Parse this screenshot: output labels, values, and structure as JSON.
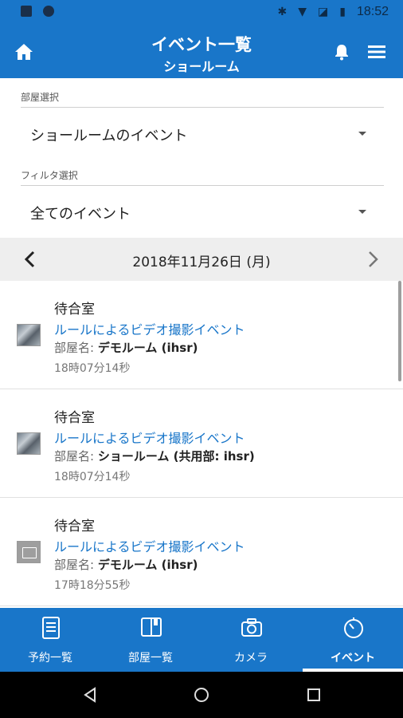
{
  "status_bar": {
    "time": "18:52"
  },
  "app_bar": {
    "title": "イベント一覧",
    "subtitle": "ショールーム"
  },
  "room_select": {
    "label": "部屋選択",
    "value": "ショールームのイベント"
  },
  "filter_select": {
    "label": "フィルタ選択",
    "value": "全てのイベント"
  },
  "date_nav": {
    "date": "2018年11月26日 (月)"
  },
  "events": [
    {
      "title": "待合室",
      "type": "ルールによるビデオ撮影イベント",
      "room_label": "部屋名:",
      "room_value": "デモルーム (ihsr)",
      "time": "18時07分14秒",
      "thumb": "photo"
    },
    {
      "title": "待合室",
      "type": "ルールによるビデオ撮影イベント",
      "room_label": "部屋名:",
      "room_value": "ショールーム (共用部: ihsr)",
      "time": "18時07分14秒",
      "thumb": "photo"
    },
    {
      "title": "待合室",
      "type": "ルールによるビデオ撮影イベント",
      "room_label": "部屋名:",
      "room_value": "デモルーム (ihsr)",
      "time": "17時18分55秒",
      "thumb": "image-placeholder"
    }
  ],
  "bottom_nav": {
    "tabs": [
      {
        "label": "予約一覧",
        "icon": "list-book-icon"
      },
      {
        "label": "部屋一覧",
        "icon": "room-book-icon"
      },
      {
        "label": "カメラ",
        "icon": "camera-icon"
      },
      {
        "label": "イベント",
        "icon": "timer-icon",
        "active": true
      }
    ]
  },
  "colors": {
    "primary": "#1976c9",
    "link": "#1976c9",
    "date_bar": "#eeeeee"
  }
}
